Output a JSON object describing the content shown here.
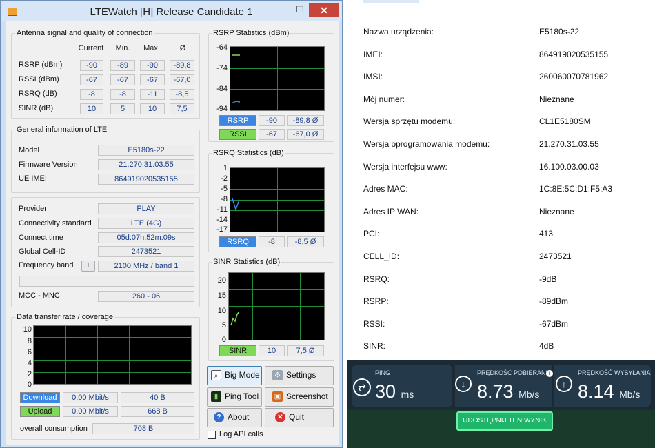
{
  "window": {
    "title": "LTEWatch [H]   Release Candidate 1",
    "minimize": "—",
    "maximize": "☐",
    "close": "✕"
  },
  "antenna": {
    "group_label": "Antenna signal and quality of connection",
    "headers": [
      "Current",
      "Min.",
      "Max.",
      "Ø"
    ],
    "rows": [
      {
        "label": "RSRP (dBm)",
        "values": [
          "-90",
          "-89",
          "-90",
          "-89,8"
        ]
      },
      {
        "label": "RSSI (dBm)",
        "values": [
          "-67",
          "-67",
          "-67",
          "-67,0"
        ]
      },
      {
        "label": "RSRQ (dB)",
        "values": [
          "-8",
          "-8",
          "-11",
          "-8,5"
        ]
      },
      {
        "label": "SINR (dB)",
        "values": [
          "10",
          "5",
          "10",
          "7,5"
        ]
      }
    ]
  },
  "general": {
    "group_label": "General information of LTE",
    "model_label": "Model",
    "model": "E5180s-22",
    "firmware_label": "Firmware Version",
    "firmware": "21.270.31.03.55",
    "imei_label": "UE IMEI",
    "imei": "864919020535155"
  },
  "provider": {
    "provider_label": "Provider",
    "provider": "PLAY",
    "standard_label": "Connectivity standard",
    "standard": "LTE (4G)",
    "time_label": "Connect time",
    "time": "05d:07h:52m:09s",
    "cell_label": "Global Cell-ID",
    "cell": "2473521",
    "band_label": "Frequency band",
    "band_btn": "+",
    "band": "2100 MHz / band 1",
    "mcc_label": "MCC - MNC",
    "mcc": "260 - 06"
  },
  "transfer": {
    "group_label": "Data transfer rate / coverage",
    "yticks": [
      "10",
      "8",
      "6",
      "4",
      "2",
      "0"
    ],
    "download_label": "Download",
    "download_rate": "0,00 Mbit/s",
    "download_bytes": "40 B",
    "upload_label": "Upload",
    "upload_rate": "0,00 Mbit/s",
    "upload_bytes": "668 B",
    "overall_label": "overall consumption",
    "overall": "708 B"
  },
  "rsrp_stats": {
    "group_label": "RSRP Statistics (dBm)",
    "yticks": [
      "-64",
      "-74",
      "-84",
      "-94"
    ],
    "rsrp_tag": "RSRP",
    "rsrp_cur": "-90",
    "rsrp_avg": "-89,8 Ø",
    "rssi_tag": "RSSI",
    "rssi_cur": "-67",
    "rssi_avg": "-67,0 Ø"
  },
  "rsrq_stats": {
    "group_label": "RSRQ Statistics (dB)",
    "yticks": [
      "1",
      "-2",
      "-5",
      "-8",
      "-11",
      "-14",
      "-17"
    ],
    "tag": "RSRQ",
    "cur": "-8",
    "avg": "-8,5 Ø"
  },
  "sinr_stats": {
    "group_label": "SINR Statistics (dB)",
    "yticks": [
      "20",
      "15",
      "10",
      "5",
      "0"
    ],
    "tag": "SINR",
    "cur": "10",
    "avg": "7,5 Ø"
  },
  "buttons": {
    "big_mode": "Big Mode",
    "settings": "Settings",
    "ping_tool": "Ping Tool",
    "screenshot": "Screenshot",
    "about": "About",
    "quit": "Quit",
    "log_api": "Log API calls"
  },
  "device_info": [
    {
      "label": "Nazwa urządzenia:",
      "value": "E5180s-22"
    },
    {
      "label": "IMEI:",
      "value": "864919020535155"
    },
    {
      "label": "IMSI:",
      "value": "260060070781962"
    },
    {
      "label": "Mój numer:",
      "value": "Nieznane"
    },
    {
      "label": "Wersja sprzętu modemu:",
      "value": "CL1E5180SM"
    },
    {
      "label": "Wersja oprogramowania modemu:",
      "value": "21.270.31.03.55"
    },
    {
      "label": "Wersja interfejsu www:",
      "value": "16.100.03.00.03"
    },
    {
      "label": "Adres MAC:",
      "value": "1C:8E:5C:D1:F5:A3"
    },
    {
      "label": "Adres IP WAN:",
      "value": "Nieznane"
    },
    {
      "label": "PCI:",
      "value": "413"
    },
    {
      "label": "CELL_ID:",
      "value": "2473521"
    },
    {
      "label": "RSRQ:",
      "value": "-9dB"
    },
    {
      "label": "RSRP:",
      "value": "-89dBm"
    },
    {
      "label": "RSSI:",
      "value": "-67dBm"
    },
    {
      "label": "SINR:",
      "value": "4dB"
    }
  ],
  "speedtest": {
    "ping_label": "PING",
    "ping_value": "30",
    "ping_unit": "ms",
    "download_label": "PRĘDKOŚĆ POBIERANIA",
    "download_value": "8.73",
    "download_unit": "Mb/s",
    "upload_label": "PRĘDKOŚĆ WYSYŁANIA",
    "upload_value": "8.14",
    "upload_unit": "Mb/s",
    "share_button": "UDOSTĘPNIJ TEN WYNIK"
  },
  "colors": {
    "rsrp_tag": "#3a86e0",
    "rssi_tag": "#7ed957",
    "download_tag": "#3a86e0",
    "upload_tag": "#7ed957",
    "grid": "#1f8f3a",
    "share_button": "#1fb56a"
  }
}
